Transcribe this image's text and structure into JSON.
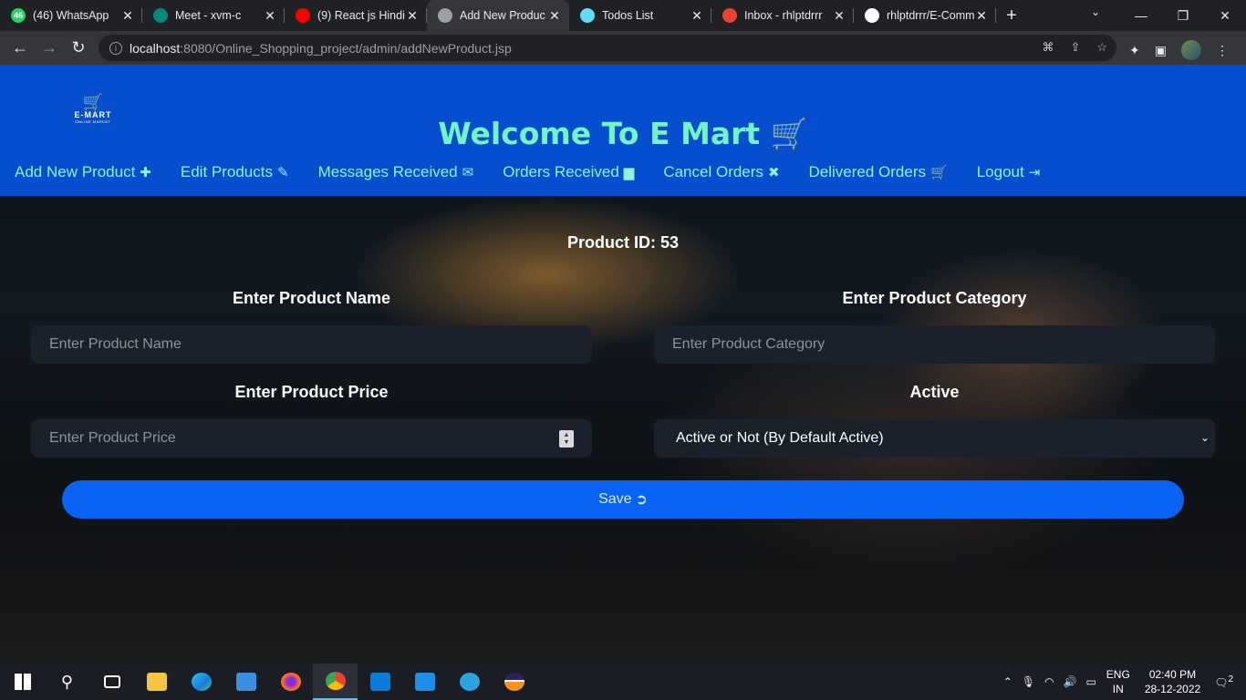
{
  "browser": {
    "tabs": [
      {
        "title": "(46) WhatsApp",
        "favicon_color": "#25d366",
        "favicon_text": "46"
      },
      {
        "title": "Meet - xvm-c",
        "favicon_color": "#00897b",
        "favicon_text": ""
      },
      {
        "title": "(9) React js Hindi",
        "favicon_color": "#ff0000",
        "favicon_text": ""
      },
      {
        "title": "Add New Produc",
        "favicon_color": "#9aa0a6",
        "favicon_text": ""
      },
      {
        "title": "Todos List",
        "favicon_color": "#61dafb",
        "favicon_text": ""
      },
      {
        "title": "Inbox - rhlptdrrr",
        "favicon_color": "#ea4335",
        "favicon_text": ""
      },
      {
        "title": "rhlptdrrr/E-Comm",
        "favicon_color": "#ffffff",
        "favicon_text": ""
      }
    ],
    "url_host": "localhost",
    "url_rest": ":8080/Online_Shopping_project/admin/addNewProduct.jsp"
  },
  "header": {
    "logo_brand": "E-MART",
    "logo_sub": "ONLINE MARKET",
    "welcome": "Welcome To E Mart",
    "menu": [
      {
        "label": "Add New Product",
        "icon": "plus-square-icon",
        "glyph": "✚"
      },
      {
        "label": "Edit Products",
        "icon": "edit-icon",
        "glyph": "✎"
      },
      {
        "label": "Messages Received",
        "icon": "envelope-icon",
        "glyph": "✉"
      },
      {
        "label": "Orders Received",
        "icon": "archive-icon",
        "glyph": "▆"
      },
      {
        "label": "Cancel Orders",
        "icon": "times-icon",
        "glyph": "✖"
      },
      {
        "label": "Delivered Orders",
        "icon": "shopping-cart-icon",
        "glyph": "🛒"
      },
      {
        "label": "Logout",
        "icon": "sign-out-icon",
        "glyph": "⇥"
      }
    ]
  },
  "form": {
    "product_id": "Product ID: 53",
    "name_label": "Enter Product Name",
    "name_placeholder": "Enter Product Name",
    "category_label": "Enter Product Category",
    "category_placeholder": "Enter Product Category",
    "price_label": "Enter Product Price",
    "price_placeholder": "Enter Product Price",
    "active_label": "Active",
    "active_selected": "Active or Not (By Default Active)",
    "save_label": "Save"
  },
  "taskbar": {
    "lang_top": "ENG",
    "lang_bottom": "IN",
    "time": "02:40 PM",
    "date": "28-12-2022",
    "notifications": "2"
  }
}
